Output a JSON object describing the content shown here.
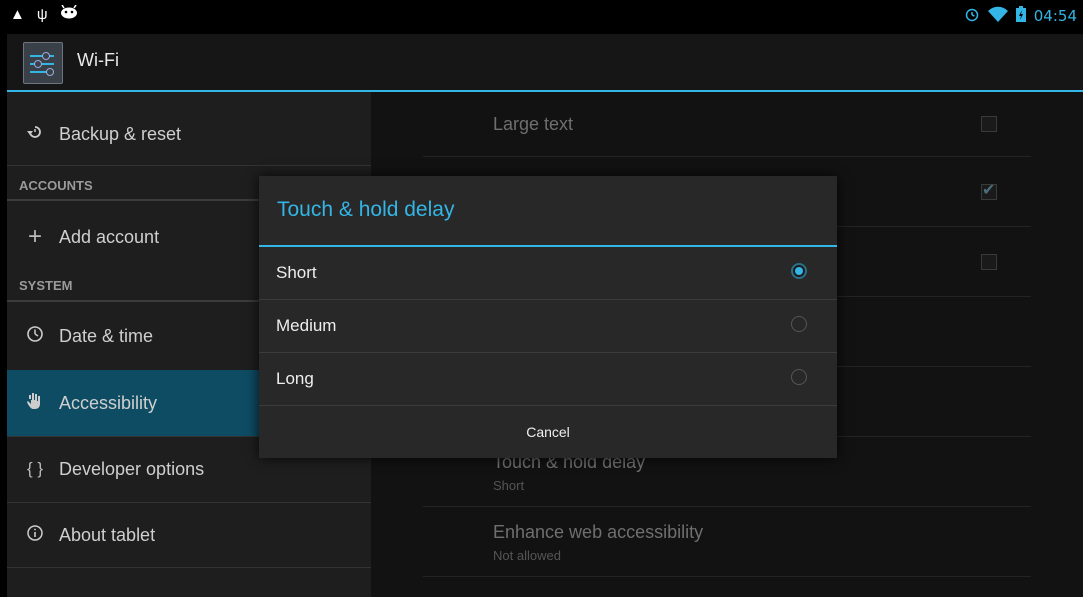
{
  "status_bar": {
    "left_icons": [
      "warning-icon",
      "usb-icon",
      "android-debug-icon"
    ],
    "right_icons": [
      "alarm-icon",
      "wifi-icon",
      "battery-icon"
    ],
    "time": "04:54"
  },
  "action_bar": {
    "icon": "settings-sliders-icon",
    "title": "Wi-Fi"
  },
  "sidebar": {
    "items": [
      {
        "label": "Backup & reset",
        "icon": "backup-reset-icon"
      },
      {
        "label": "Add account",
        "icon": "plus-icon"
      },
      {
        "label": "Date & time",
        "icon": "clock-icon"
      },
      {
        "label": "Accessibility",
        "icon": "hand-icon"
      },
      {
        "label": "Developer options",
        "icon": "braces-icon"
      },
      {
        "label": "About tablet",
        "icon": "info-icon"
      }
    ],
    "sections": {
      "accounts": "ACCOUNTS",
      "system": "SYSTEM"
    },
    "selected": "Accessibility"
  },
  "content": {
    "large_text": {
      "title": "Large text",
      "checked": false
    },
    "row2": {
      "checked": true
    },
    "row3": {
      "checked": false
    },
    "touch_hold": {
      "title": "Touch & hold delay",
      "summary": "Short"
    },
    "web_access": {
      "title": "Enhance web accessibility",
      "summary": "Not allowed"
    }
  },
  "dialog": {
    "title": "Touch & hold delay",
    "options": [
      {
        "label": "Short",
        "selected": true
      },
      {
        "label": "Medium",
        "selected": false
      },
      {
        "label": "Long",
        "selected": false
      }
    ],
    "cancel_label": "Cancel"
  },
  "colors": {
    "accent": "#33b5e5",
    "selected_row": "#0e4c63"
  }
}
